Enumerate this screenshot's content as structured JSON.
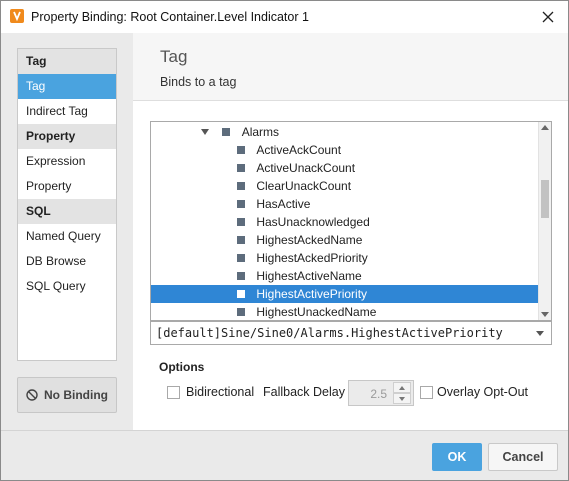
{
  "window": {
    "title": "Property Binding: Root Container.Level Indicator 1"
  },
  "sidebar": {
    "groups": [
      {
        "label": "Tag",
        "items": [
          "Tag",
          "Indirect Tag"
        ]
      },
      {
        "label": "Property",
        "items": [
          "Expression",
          "Property"
        ]
      },
      {
        "label": "SQL",
        "items": [
          "Named Query",
          "DB Browse",
          "SQL Query"
        ]
      }
    ],
    "selected": "Tag",
    "no_binding_label": "No Binding"
  },
  "header": {
    "title": "Tag",
    "subtitle": "Binds to a tag"
  },
  "tree": {
    "parent": "Alarms",
    "children": [
      "ActiveAckCount",
      "ActiveUnackCount",
      "ClearUnackCount",
      "HasActive",
      "HasUnacknowledged",
      "HighestAckedName",
      "HighestAckedPriority",
      "HighestActiveName",
      "HighestActivePriority",
      "HighestUnackedName"
    ],
    "selected": "HighestActivePriority"
  },
  "path": {
    "value": "[default]Sine/Sine0/Alarms.HighestActivePriority"
  },
  "options": {
    "title": "Options",
    "bidirectional_label": "Bidirectional",
    "fallback_delay_label": "Fallback Delay",
    "fallback_delay_value": "2.5",
    "overlay_opt_out_label": "Overlay Opt-Out"
  },
  "footer": {
    "ok_label": "OK",
    "cancel_label": "Cancel"
  },
  "colors": {
    "accent": "#4aa3df",
    "selection": "#2f86d5",
    "app_icon": "#f08a1c"
  }
}
